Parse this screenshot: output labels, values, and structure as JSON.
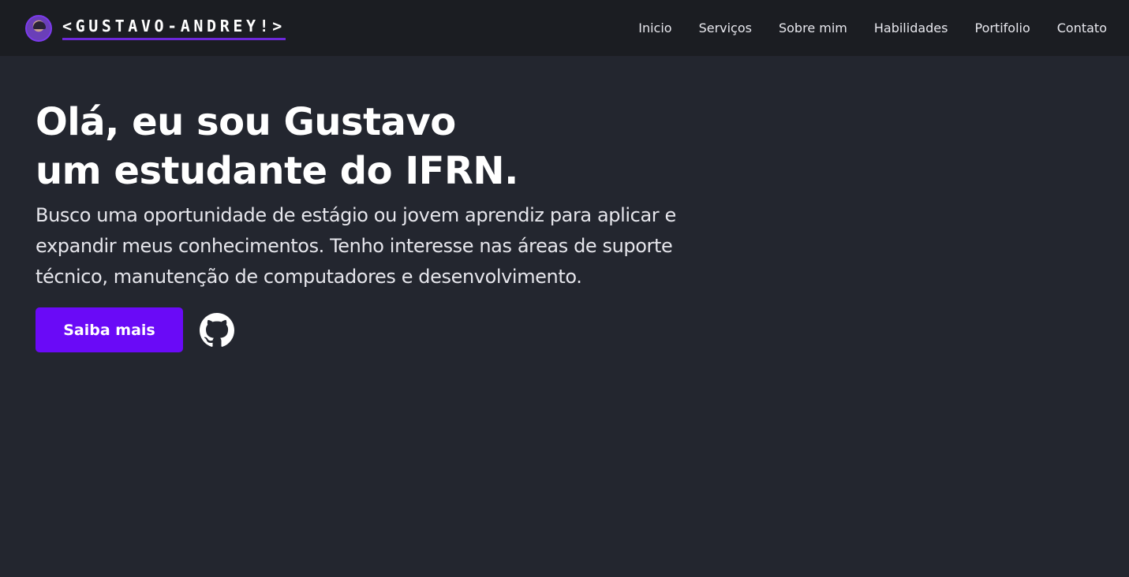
{
  "header": {
    "brand_name": "<GUSTAVO-ANDREY!>",
    "avatar_alt": "avatar",
    "nav": [
      {
        "label": "Inicio"
      },
      {
        "label": "Serviços"
      },
      {
        "label": "Sobre mim"
      },
      {
        "label": "Habilidades"
      },
      {
        "label": "Portifolio"
      },
      {
        "label": "Contato"
      }
    ]
  },
  "hero": {
    "title_line1": "Olá, eu sou Gustavo",
    "title_line2": "um estudante do IFRN.",
    "description": "Busco uma oportunidade de estágio ou jovem aprendiz para aplicar e expandir meus conhecimentos. Tenho interesse nas áreas de suporte técnico, manutenção de computadores e desenvolvimento.",
    "cta_label": "Saiba mais",
    "github_icon": "github-icon"
  },
  "colors": {
    "background": "#23262f",
    "navbar": "#1b1d22",
    "accent": "#6a0af7",
    "brand_underline": "#6d28d9",
    "text": "#ffffff"
  }
}
